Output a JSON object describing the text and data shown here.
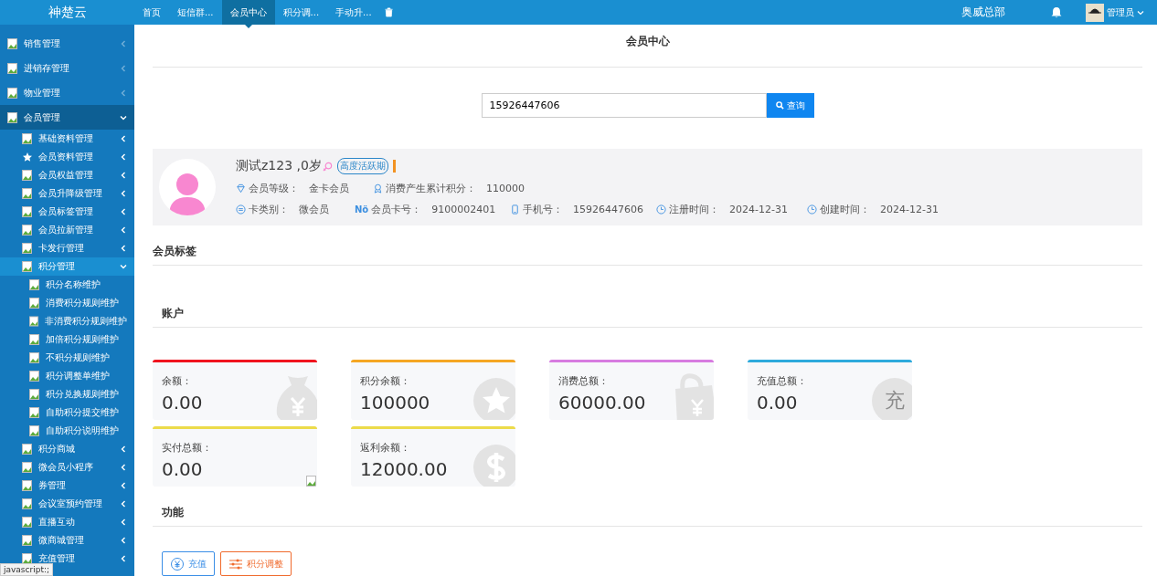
{
  "brand": "神楚云",
  "tabs": [
    {
      "label": "首页",
      "selected": false
    },
    {
      "label": "短信群...",
      "selected": false
    },
    {
      "label": "会员中心",
      "selected": true
    },
    {
      "label": "积分调...",
      "selected": false
    },
    {
      "label": "手动升...",
      "selected": false
    }
  ],
  "org": "奥威总部",
  "user": "管理员",
  "sidebar": {
    "items": [
      {
        "label": "销售管理",
        "expanded": false
      },
      {
        "label": "进销存管理",
        "expanded": false
      },
      {
        "label": "物业管理",
        "expanded": false
      },
      {
        "label": "会员管理",
        "expanded": true,
        "children": [
          {
            "label": "基础资料管理",
            "expanded": false
          },
          {
            "label": "会员资料管理",
            "expanded": false,
            "kind": "star"
          },
          {
            "label": "会员权益管理",
            "expanded": false
          },
          {
            "label": "会员升降级管理",
            "expanded": false
          },
          {
            "label": "会员标签管理",
            "expanded": false
          },
          {
            "label": "会员拉新管理",
            "expanded": false
          },
          {
            "label": "卡发行管理",
            "expanded": false
          },
          {
            "label": "积分管理",
            "expanded": true,
            "children": [
              {
                "label": "积分名称维护"
              },
              {
                "label": "消费积分规则维护"
              },
              {
                "label": "非消费积分规则维护"
              },
              {
                "label": "加倍积分规则维护"
              },
              {
                "label": "不积分规则维护"
              },
              {
                "label": "积分调整单维护"
              },
              {
                "label": "积分兑换规则维护"
              },
              {
                "label": "自助积分提交维护"
              },
              {
                "label": "自助积分说明维护"
              }
            ]
          },
          {
            "label": "积分商城",
            "expanded": false
          },
          {
            "label": "微会员小程序",
            "expanded": false
          },
          {
            "label": "券管理",
            "expanded": false
          },
          {
            "label": "会议室预约管理",
            "expanded": false
          },
          {
            "label": "直播互动",
            "expanded": false
          },
          {
            "label": "微商城管理",
            "expanded": false
          },
          {
            "label": "充值管理",
            "expanded": false
          }
        ]
      }
    ]
  },
  "status_bar": "javascript:;",
  "page_title": "会员中心",
  "search": {
    "value": "15926447606",
    "button": "查询"
  },
  "member": {
    "name": "测试z123 ,0岁",
    "tag": "高度活跃期",
    "fields": [
      [
        {
          "kind": "diamond",
          "label": "会员等级：",
          "value": "金卡会员"
        },
        {
          "kind": "award",
          "label": "消费产生累计积分：",
          "value": "110000"
        }
      ],
      [
        {
          "kind": "card",
          "label": "卡类别：",
          "value": "微会员"
        },
        {
          "kind": "number",
          "label": "会员卡号：",
          "value": "9100002401"
        },
        {
          "kind": "phone",
          "label": "手机号：",
          "value": "15926447606"
        },
        {
          "kind": "clock",
          "label": "注册时间：",
          "value": "2024-12-31"
        },
        {
          "kind": "clock",
          "label": "创建时间：",
          "value": "2024-12-31"
        }
      ]
    ]
  },
  "no_icon_text": "Nö",
  "sections": {
    "tags": "会员标签",
    "account": "账户",
    "functions": "功能"
  },
  "accounts": [
    {
      "label": "余额：",
      "value": "0.00",
      "color": "#f0141e",
      "kind": "moneybag"
    },
    {
      "label": "积分余额：",
      "value": "100000",
      "color": "#f5a623",
      "kind": "star"
    },
    {
      "label": "消费总额：",
      "value": "60000.00",
      "color": "#d77be0",
      "kind": "bag"
    },
    {
      "label": "充值总额：",
      "value": "0.00",
      "color": "#2eaadc",
      "kind": "glyph",
      "glyph": "充"
    },
    {
      "label": "实付总额：",
      "value": "0.00",
      "color": "#ecdb4a",
      "kind": "image"
    },
    {
      "label": "返利余额：",
      "value": "12000.00",
      "color": "#ecdb4a",
      "kind": "dollar"
    }
  ],
  "actions": [
    {
      "label": "充值",
      "kind": "recharge"
    },
    {
      "label": "积分调整",
      "kind": "adjust"
    }
  ]
}
